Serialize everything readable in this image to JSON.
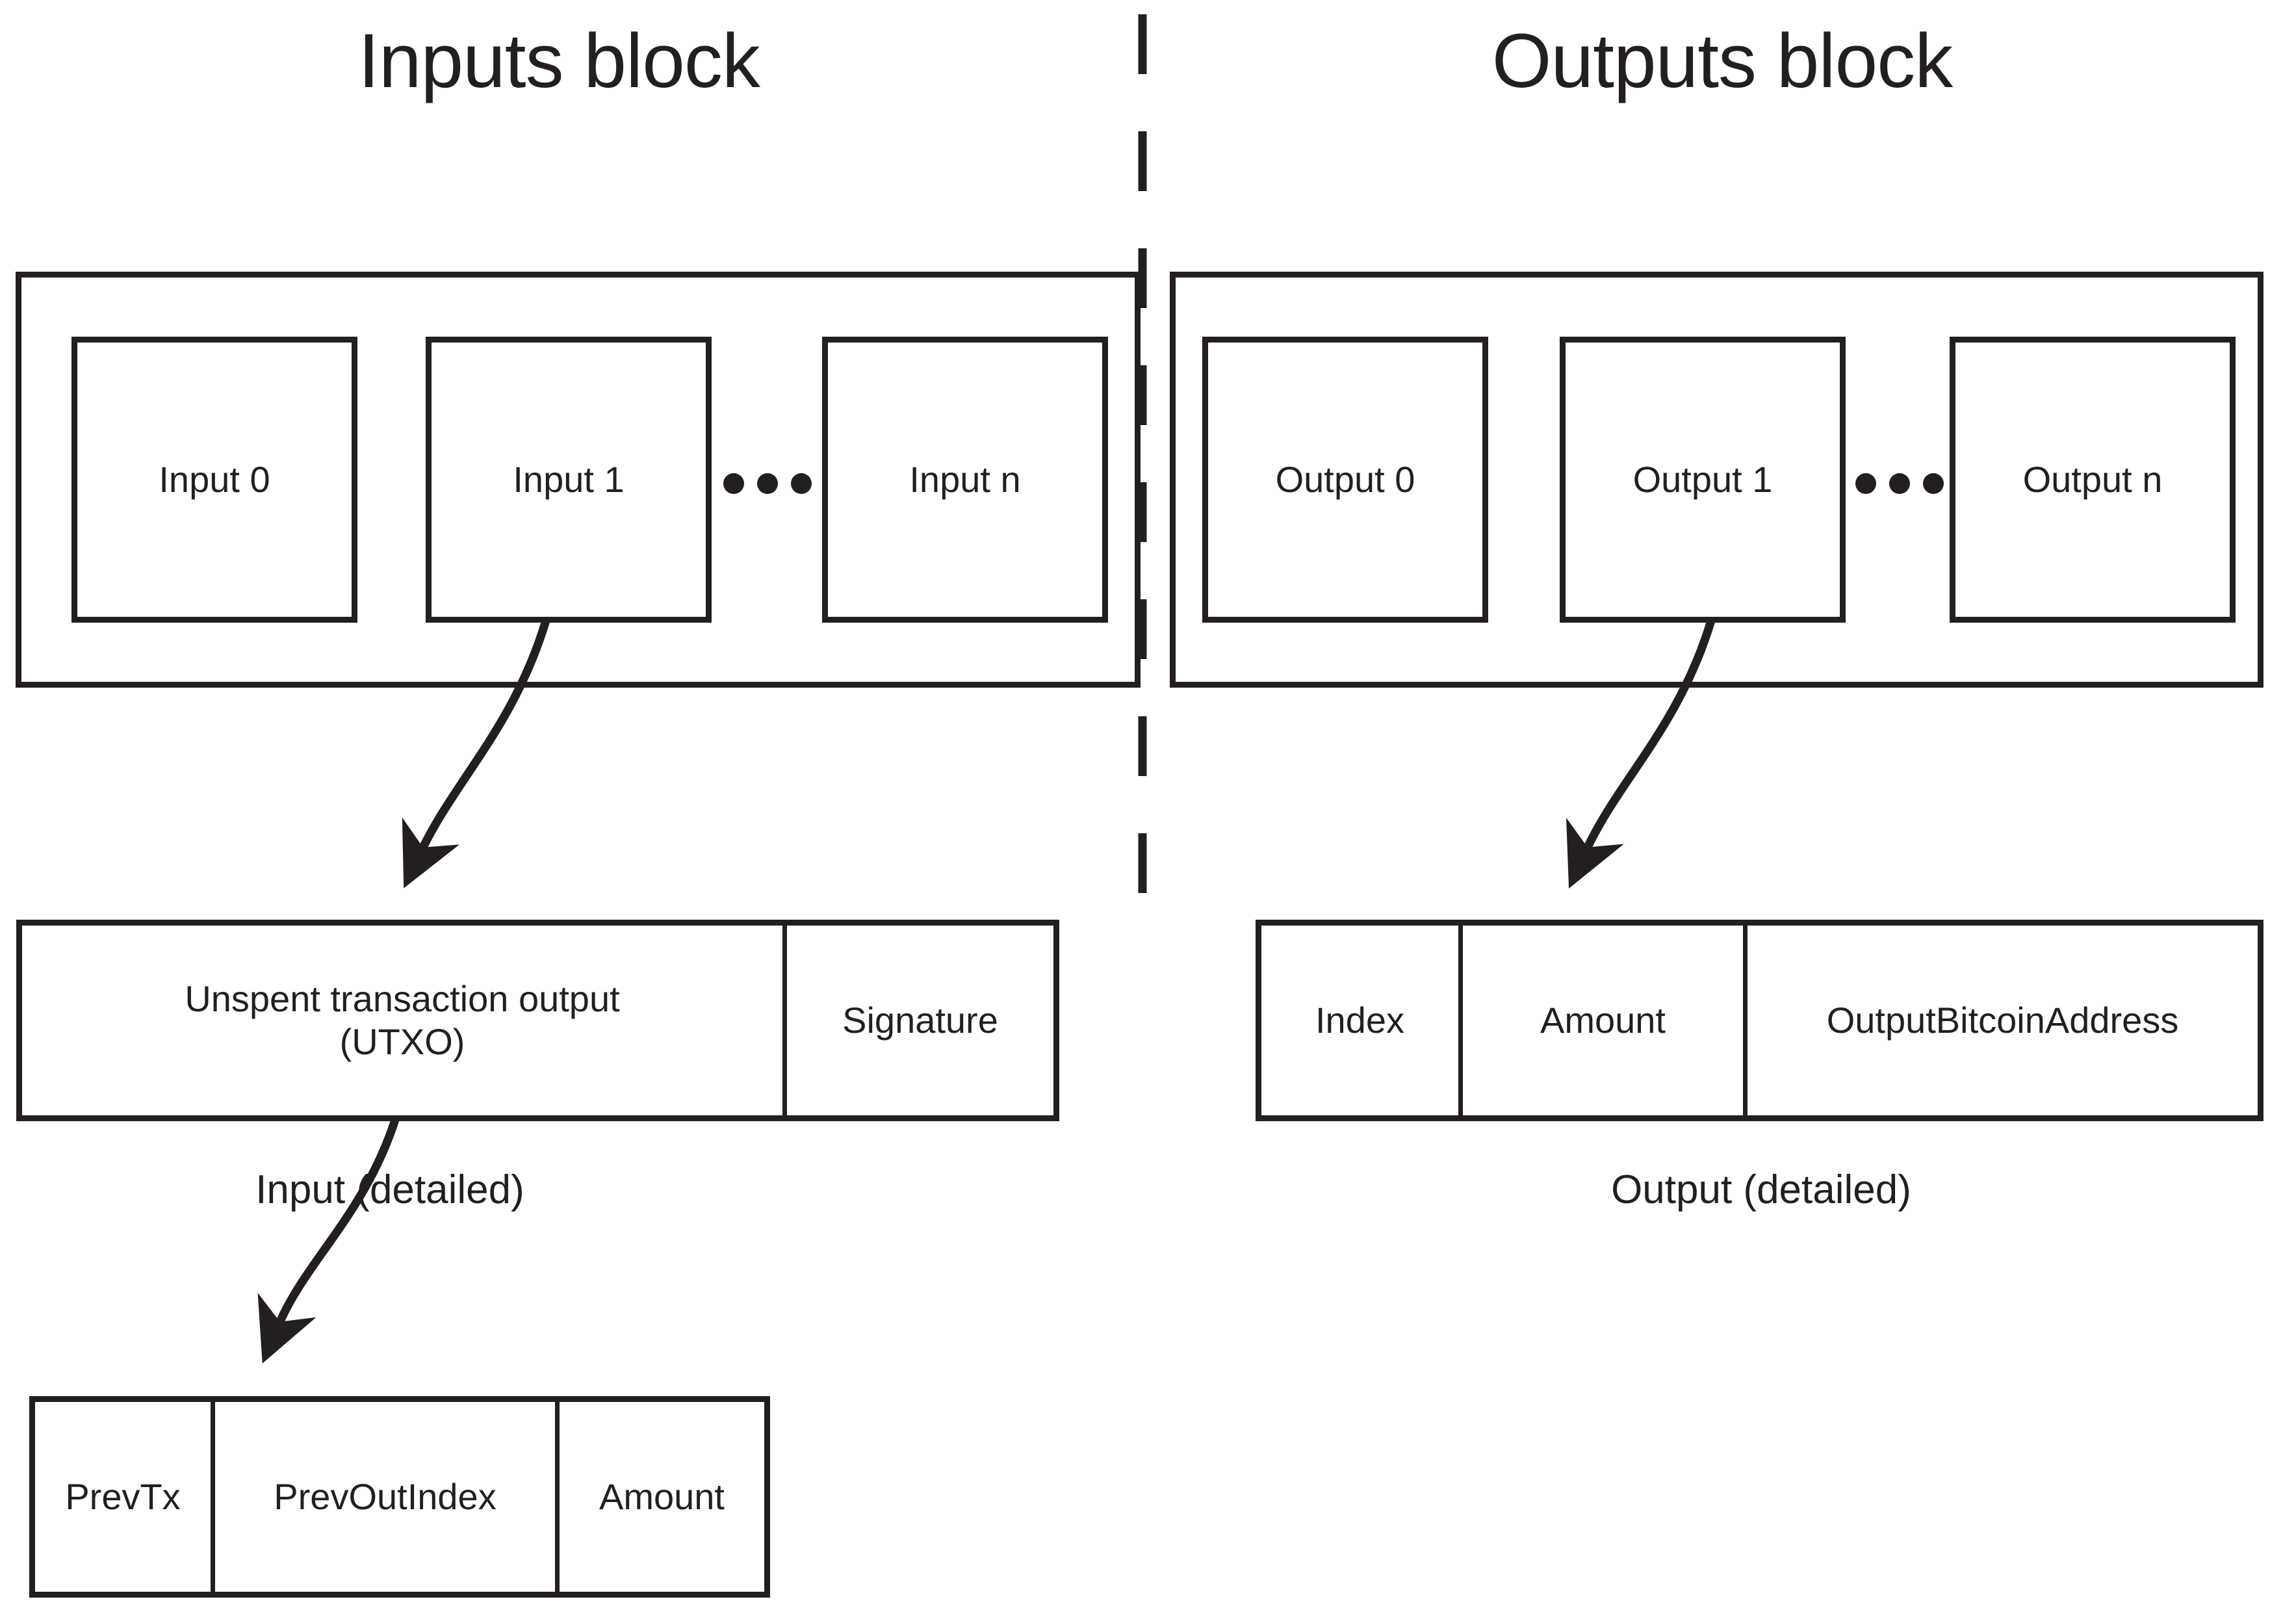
{
  "titles": {
    "inputs": "Inputs block",
    "outputs": "Outputs block"
  },
  "inputs_block": {
    "items": [
      {
        "label": "Input 0"
      },
      {
        "label": "Input 1"
      },
      {
        "label": "Input n"
      }
    ],
    "ellipsis": "..."
  },
  "outputs_block": {
    "items": [
      {
        "label": "Output 0"
      },
      {
        "label": "Output 1"
      },
      {
        "label": "Output n"
      }
    ],
    "ellipsis": "..."
  },
  "input_detail": {
    "caption": "Input (detailed)",
    "cells": [
      {
        "line1": "Unspent transaction output",
        "line2": "(UTXO)"
      },
      {
        "line1": "Signature",
        "line2": ""
      }
    ]
  },
  "output_detail": {
    "caption": "Output (detailed)",
    "cells": [
      {
        "label": "Index"
      },
      {
        "label": "Amount"
      },
      {
        "label": "OutputBitcoinAddress"
      }
    ]
  },
  "utxo_detail": {
    "cells": [
      {
        "label": "PrevTx"
      },
      {
        "label": "PrevOutIndex"
      },
      {
        "label": "Amount"
      }
    ]
  },
  "colors": {
    "ink": "#231f20",
    "background": "#ffffff"
  }
}
